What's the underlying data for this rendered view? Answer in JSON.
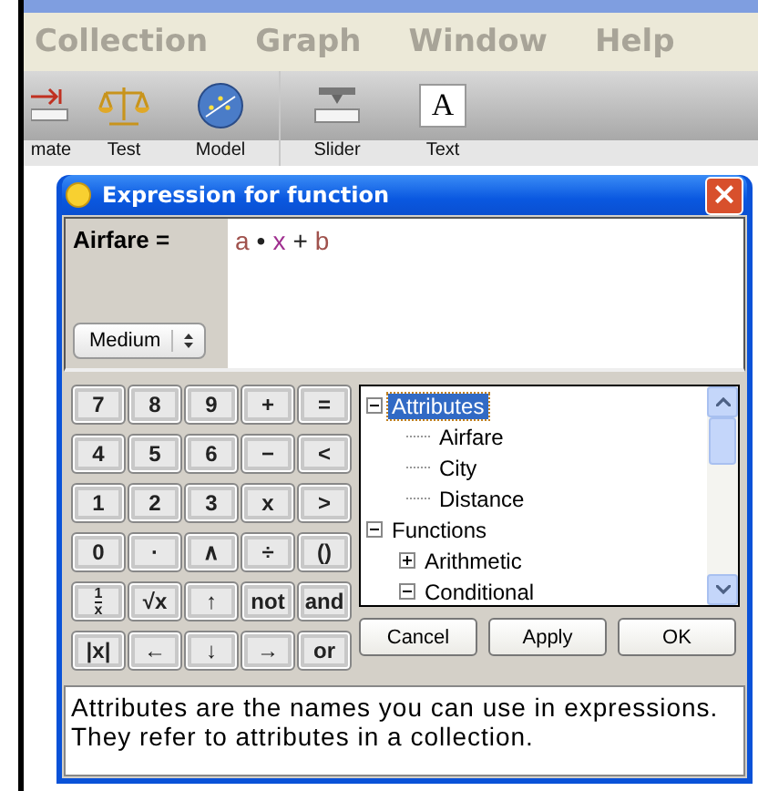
{
  "menu": [
    "Collection",
    "Graph",
    "Window",
    "Help"
  ],
  "toolbar": [
    {
      "label": "mate",
      "kind": "ruler"
    },
    {
      "label": "Test",
      "kind": "scales"
    },
    {
      "label": "Model",
      "kind": "globe"
    },
    {
      "label": "Slider",
      "kind": "slider"
    },
    {
      "label": "Text",
      "kind": "text",
      "glyph": "A"
    }
  ],
  "dialog": {
    "title": "Expression for function",
    "close": "×",
    "attribute_label": "Airfare =",
    "expression": [
      {
        "text": "a",
        "color": "#a0524d"
      },
      {
        "text": "•",
        "color": "#222222"
      },
      {
        "text": "x",
        "color": "#a03090"
      },
      {
        "text": "+",
        "color": "#222222"
      },
      {
        "text": "b",
        "color": "#a0524d"
      }
    ],
    "size_select": "Medium",
    "keys": [
      {
        "label": "7"
      },
      {
        "label": "8"
      },
      {
        "label": "9"
      },
      {
        "label": "+"
      },
      {
        "label": "="
      },
      {
        "label": "4"
      },
      {
        "label": "5"
      },
      {
        "label": "6"
      },
      {
        "label": "−"
      },
      {
        "label": "<"
      },
      {
        "label": "1"
      },
      {
        "label": "2"
      },
      {
        "label": "3"
      },
      {
        "label": "x"
      },
      {
        "label": ">"
      },
      {
        "label": "0"
      },
      {
        "label": "·"
      },
      {
        "label": "∧"
      },
      {
        "label": "÷"
      },
      {
        "label": "()"
      },
      {
        "kind": "fraction",
        "numerator": "1",
        "denominator": "x"
      },
      {
        "label": "√x"
      },
      {
        "label": "↑"
      },
      {
        "label": "not"
      },
      {
        "label": "and"
      },
      {
        "label": "|x|"
      },
      {
        "label": "←"
      },
      {
        "label": "↓"
      },
      {
        "label": "→"
      },
      {
        "label": "or"
      }
    ],
    "tree": [
      {
        "label": "Attributes",
        "expanded": true,
        "selected": true,
        "children": [
          {
            "label": "Airfare",
            "selected": false
          },
          {
            "label": "City",
            "selected": false
          },
          {
            "label": "Distance",
            "selected": false
          }
        ]
      },
      {
        "label": "Functions",
        "expanded": true,
        "selected": false,
        "children": [
          {
            "label": "Arithmetic",
            "expanded": false,
            "selected": false
          },
          {
            "label": "Conditional",
            "expanded": true,
            "selected": false
          }
        ]
      }
    ],
    "buttons": [
      "Cancel",
      "Apply",
      "OK"
    ],
    "description": "Attributes are the names you can use in expressions. They refer to attributes in a collection."
  }
}
